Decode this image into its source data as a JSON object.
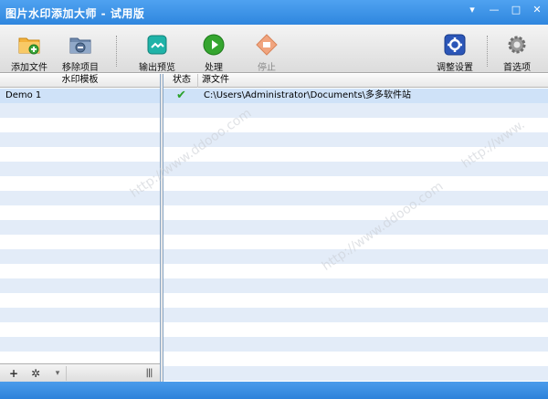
{
  "window": {
    "title": "图片水印添加大师 - 试用版"
  },
  "toolbar": {
    "add_file": "添加文件",
    "remove_item": "移除项目",
    "output_preview": "输出预览",
    "process": "处理",
    "stop": "停止",
    "adjust_settings": "调整设置",
    "preferences": "首选项"
  },
  "left_panel": {
    "header": "水印模板",
    "items": [
      "Demo 1"
    ]
  },
  "right_panel": {
    "columns": {
      "status": "状态",
      "source": "源文件"
    },
    "rows": [
      {
        "status": "✔",
        "source": "C:\\Users\\Administrator\\Documents\\多多软件站"
      }
    ]
  },
  "left_tools": {
    "add": "+",
    "gear": "✲",
    "drop": "▾",
    "columns": "|||"
  },
  "colors": {
    "title_blue": "#2f86de",
    "stripe": "#e3ecf8",
    "selection": "#cfe2f8",
    "check_green": "#2aa12a"
  }
}
